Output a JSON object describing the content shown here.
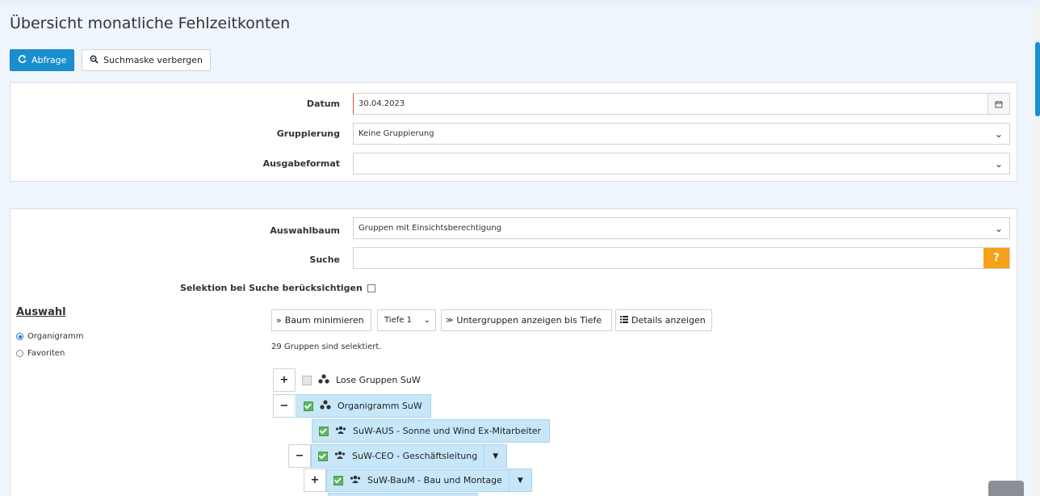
{
  "page": {
    "title": "Übersicht monatliche Fehlzeitkonten"
  },
  "toolbar": {
    "abfrage": "Abfrage",
    "suchmaske": "Suchmaske verbergen"
  },
  "form1": {
    "datum_label": "Datum",
    "datum_value": "30.04.2023",
    "gruppierung_label": "Gruppierung",
    "gruppierung_value": "Keine Gruppierung",
    "ausgabe_label": "Ausgabeformat",
    "ausgabe_value": ""
  },
  "form2": {
    "baum_label": "Auswahlbaum",
    "baum_value": "Gruppen mit Einsichtsberechtigung",
    "suche_label": "Suche",
    "suche_value": "",
    "help": "?",
    "selektion_label": "Selektion bei Suche berücksichtigen"
  },
  "auswahl": {
    "heading": "Auswahl",
    "options": [
      "Organigramm",
      "Favoriten"
    ]
  },
  "tree_toolbar": {
    "minimize": "Baum minimieren",
    "tiefe": "Tiefe 1",
    "untergruppen": "Untergruppen anzeigen bis Tiefe",
    "details": "Details anzeigen"
  },
  "status": {
    "count": "29 Gruppen sind selektiert."
  },
  "tree": {
    "items": [
      {
        "toggle": "+",
        "label": "Lose Gruppen SuW"
      },
      {
        "toggle": "−",
        "label": "Organigramm SuW"
      },
      {
        "toggle": "",
        "label": "SuW-AUS - Sonne und Wind Ex-Mitarbeiter"
      },
      {
        "toggle": "−",
        "label": "SuW-CEO - Geschäftsleitung"
      },
      {
        "toggle": "+",
        "label": "SuW-BauM - Bau und Montage"
      }
    ]
  },
  "colors": {
    "primary": "#1a8fd0",
    "selected": "#c7e7f9",
    "help": "#f6a11a",
    "check": "#5cb85c"
  }
}
